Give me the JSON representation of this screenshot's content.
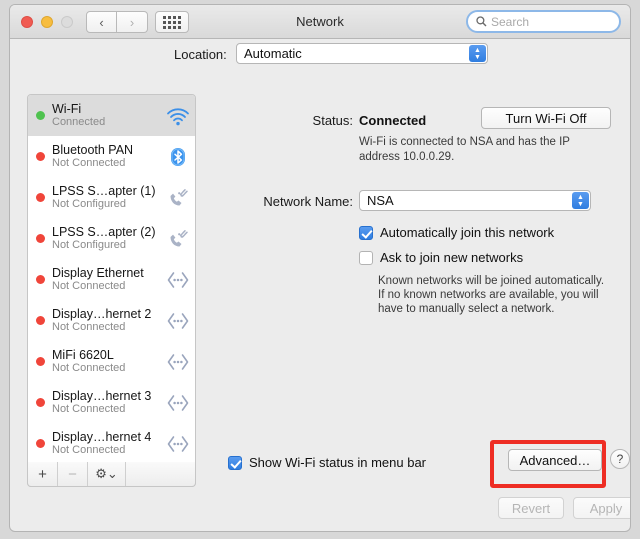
{
  "window": {
    "title": "Network",
    "traffic_lights": [
      "close",
      "minimize",
      "zoom"
    ]
  },
  "toolbar": {
    "back_glyph": "‹",
    "forward_glyph": "›",
    "grid_name": "show-all-preferences",
    "search": {
      "placeholder": "Search",
      "value": ""
    }
  },
  "location": {
    "label": "Location:",
    "value": "Automatic"
  },
  "sidebar": {
    "services": [
      {
        "name": "Wi-Fi",
        "status": "Connected",
        "dot": "green",
        "icon": "wifi-icon",
        "selected": true
      },
      {
        "name": "Bluetooth PAN",
        "status": "Not Connected",
        "dot": "red",
        "icon": "bluetooth-icon",
        "selected": false
      },
      {
        "name": "LPSS S…apter (1)",
        "status": "Not Configured",
        "dot": "red",
        "icon": "modem-icon",
        "selected": false
      },
      {
        "name": "LPSS S…apter (2)",
        "status": "Not Configured",
        "dot": "red",
        "icon": "modem-icon",
        "selected": false
      },
      {
        "name": "Display Ethernet",
        "status": "Not Connected",
        "dot": "red",
        "icon": "ethernet-icon",
        "selected": false
      },
      {
        "name": "Display…hernet 2",
        "status": "Not Connected",
        "dot": "red",
        "icon": "ethernet-icon",
        "selected": false
      },
      {
        "name": "MiFi 6620L",
        "status": "Not Connected",
        "dot": "red",
        "icon": "ethernet-icon",
        "selected": false
      },
      {
        "name": "Display…hernet 3",
        "status": "Not Connected",
        "dot": "red",
        "icon": "ethernet-icon",
        "selected": false
      },
      {
        "name": "Display…hernet 4",
        "status": "Not Connected",
        "dot": "red",
        "icon": "ethernet-icon",
        "selected": false
      }
    ],
    "toolbar": {
      "add": "+",
      "remove": "−",
      "gear": "⚙",
      "gear_chevron": "⌄"
    }
  },
  "detail": {
    "status_label": "Status:",
    "status_value": "Connected",
    "wifi_toggle_label": "Turn Wi-Fi Off",
    "status_detail": "Wi-Fi is connected to NSA and has the IP address 10.0.0.29.",
    "network_name_label": "Network Name:",
    "network_name_value": "NSA",
    "auto_join_label": "Automatically join this network",
    "auto_join_checked": true,
    "ask_join_label": "Ask to join new networks",
    "ask_join_checked": false,
    "hint": "Known networks will be joined automatically. If no known networks are available, you will have to manually select a network.",
    "show_menubar_label": "Show Wi-Fi status in menu bar",
    "show_menubar_checked": true,
    "advanced_label": "Advanced…",
    "help_label": "?"
  },
  "footer": {
    "revert_label": "Revert",
    "apply_label": "Apply"
  },
  "annotation": {
    "color": "#ee2d24",
    "target": "advanced-button"
  }
}
